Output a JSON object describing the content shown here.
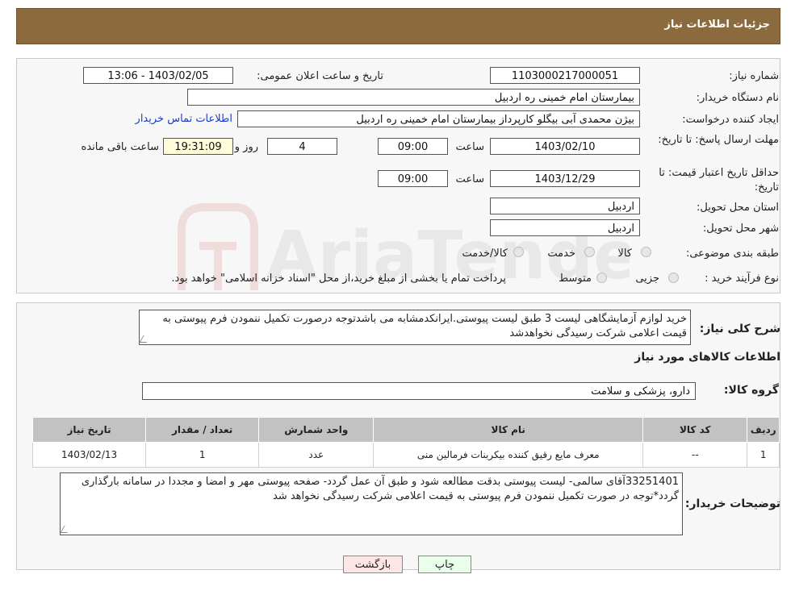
{
  "header": {
    "title": "جزئیات اطلاعات نیاز"
  },
  "form": {
    "need_number_label": "شماره نیاز:",
    "need_number": "1103000217000051",
    "announce_label": "تاریخ و ساعت اعلان عمومی:",
    "announce_value": "1403/02/05 - 13:06",
    "buyer_org_label": "نام دستگاه خریدار:",
    "buyer_org": "بیمارستان امام خمینی  ره  اردبیل",
    "creator_label": "ایجاد کننده درخواست:",
    "creator": "بیژن محمدی آبی بیگلو کارپرداز بیمارستان امام خمینی  ره  اردبیل",
    "contact_link": "اطلاعات تماس خریدار",
    "deadline_label": "مهلت ارسال پاسخ: تا تاریخ:",
    "deadline_date": "1403/02/10",
    "time_label": "ساعت",
    "deadline_time": "09:00",
    "days_value": "4",
    "days_label": "روز و",
    "remaining_time": "19:31:09",
    "remaining_label": "ساعت باقی مانده",
    "validity_label": "حداقل تاریخ اعتبار قیمت: تا تاریخ:",
    "validity_date": "1403/12/29",
    "validity_time": "09:00",
    "province_label": "استان محل تحویل:",
    "province": "اردبیل",
    "city_label": "شهر محل تحویل:",
    "city": "اردبیل",
    "category_label": "طبقه بندی موضوعی:",
    "category_options": [
      "کالا",
      "خدمت",
      "کالا/خدمت"
    ],
    "process_label": "نوع فرآیند خرید :",
    "process_options": [
      "جزیی",
      "متوسط"
    ],
    "process_note": "پرداخت تمام یا بخشی از مبلغ خرید،از محل \"اسناد خزانه اسلامی\" خواهد بود."
  },
  "description": {
    "label": "شرح کلی نیاز:",
    "text": "خرید لوازم آزمایشگاهی لیست 3 طبق لیست پیوستی.ایرانکدمشابه می باشدتوجه درصورت تکمیل ننمودن فرم پیوستی به قیمت اعلامی شرکت رسیدگی نخواهدشد"
  },
  "goods": {
    "section_title": "اطلاعات کالاهای مورد نیاز",
    "group_label": "گروه کالا:",
    "group_value": "دارو، پزشکی و سلامت",
    "columns": [
      "ردیف",
      "کد کالا",
      "نام کالا",
      "واحد شمارش",
      "تعداد / مقدار",
      "تاریخ نیاز"
    ],
    "rows": [
      {
        "row": "1",
        "code": "--",
        "name": "معرف مایع رقیق کننده بیکربنات فرمالین منی",
        "unit": "عدد",
        "qty": "1",
        "date": "1403/02/13"
      }
    ]
  },
  "buyer_notes": {
    "label": "توضیحات خریدار:",
    "text": "33251401آقای سالمی- لیست پیوستی بدقت مطالعه شود و طبق آن عمل گردد- صفحه پیوستی مهر و امضا و مجددا در سامانه بارگذاری گردد*توجه در صورت تکمیل ننمودن فرم پیوستی به قیمت اعلامی شرکت رسیدگی نخواهد شد"
  },
  "buttons": {
    "print": "چاپ",
    "back": "بازگشت"
  },
  "watermark": {
    "text": "AriaTender.neT"
  },
  "colors": {
    "header_bg": "#8B6A3E",
    "print_bg": "#eaffea",
    "back_bg": "#ffe6e6",
    "link": "#1a3cc8"
  }
}
